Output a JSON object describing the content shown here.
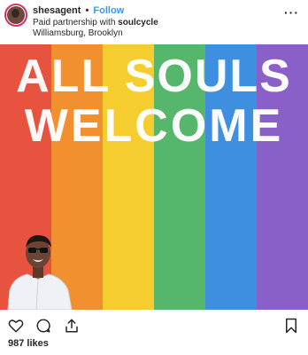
{
  "post": {
    "username": "shesagent",
    "separator": "•",
    "follow_label": "Follow",
    "partnership_prefix": "Paid partnership with",
    "partner": "soulcycle",
    "location": "Williamsburg, Brooklyn",
    "more_label": "···"
  },
  "image": {
    "mural_line1": "ALL SOULS",
    "mural_line2": "WELCOME",
    "stripe_colors": [
      "#e8533f",
      "#f2902f",
      "#f5cd2f",
      "#56b66b",
      "#3f8fe0",
      "#8a5fc7"
    ]
  },
  "actions": {
    "icons": [
      "heart-icon",
      "comment-icon",
      "share-icon",
      "bookmark-icon"
    ]
  },
  "likes_text": "987 likes"
}
